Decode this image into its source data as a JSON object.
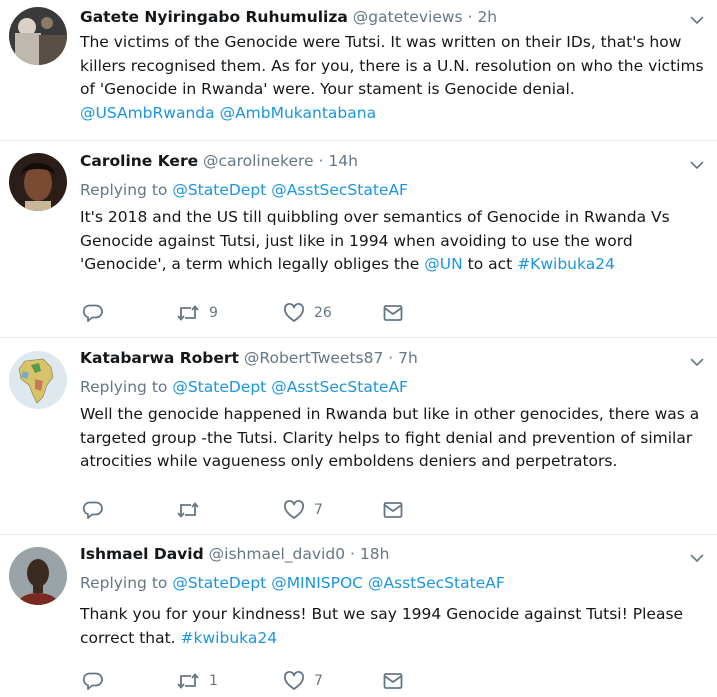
{
  "tweets": [
    {
      "name": "Gatete Nyiringabo Ruhumuliza",
      "handle": "@gateteviews",
      "dot": "·",
      "time": "2h",
      "text_lines": [
        "The victims of the Genocide were Tutsi. It was written on their IDs, that's how",
        "killers recognised them. As for you, there is a U.N. resolution on who the victims",
        "of 'Genocide in Rwanda' were. Your stament is Genocide denial."
      ],
      "mention_line": [
        "@USAmbRwanda",
        "@AmbMukantabana"
      ]
    },
    {
      "name": "Caroline Kere",
      "handle": "@carolinekere",
      "dot": "·",
      "time": "14h",
      "replying_label": "Replying to",
      "replying_to": [
        "@StateDept",
        "@AsstSecStateAF"
      ],
      "text_lines": [
        "It's 2018 and the US till quibbling over semantics of Genocide in Rwanda Vs",
        "Genocide against Tutsi, just like in 1994 when avoiding to use the word"
      ],
      "line3_a": "'Genocide', a term which legally obliges the",
      "line3_mention": "@UN",
      "line3_b": "to act",
      "line3_hashtag": "#Kwibuka24",
      "retweets": "9",
      "likes": "26"
    },
    {
      "name": "Katabarwa Robert",
      "handle": "@RobertTweets87",
      "dot": "·",
      "time": "7h",
      "replying_label": "Replying to",
      "replying_to": [
        "@StateDept",
        "@AsstSecStateAF"
      ],
      "text_lines": [
        "Well the genocide happened in  Rwanda but like in other genocides, there was a",
        "targeted group -the Tutsi. Clarity helps to fight denial and prevention of similar",
        "atrocities while vagueness only emboldens deniers and perpetrators."
      ],
      "likes": "7"
    },
    {
      "name": "Ishmael David",
      "handle": "@ishmael_david0",
      "dot": "·",
      "time": "18h",
      "replying_label": "Replying to",
      "replying_to": [
        "@StateDept",
        "@MINISPOC",
        "@AsstSecStateAF"
      ],
      "text_lines": [
        "Thank you for your kindness! But we say 1994 Genocide against Tutsi! Please"
      ],
      "line2_a": "correct that.",
      "line2_hashtag": "#kwibuka24",
      "retweets": "1",
      "likes": "7"
    }
  ],
  "colors": {
    "name": "#14171a",
    "meta": "#657786",
    "link": "#1b95e0",
    "divider": "#e6ecf0"
  },
  "icons": [
    "chevron-down-icon",
    "reply-icon",
    "retweet-icon",
    "like-icon",
    "direct-message-icon"
  ]
}
